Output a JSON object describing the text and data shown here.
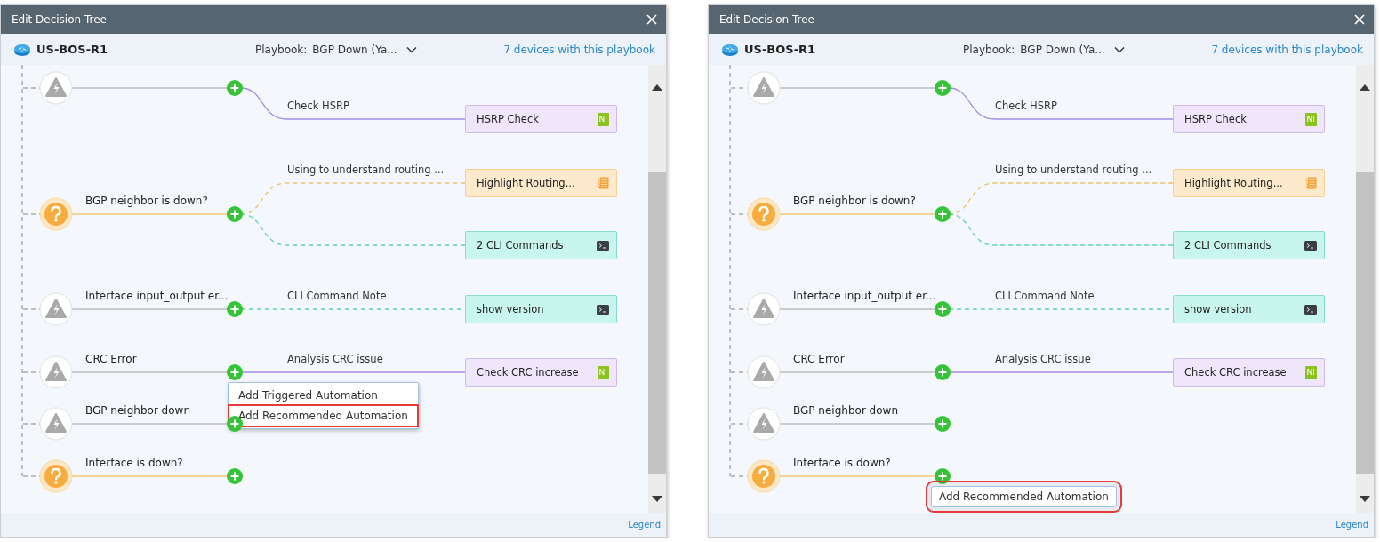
{
  "panels": [
    {
      "title": "Edit Decision Tree",
      "device": "US-BOS-R1",
      "playbook_label": "Playbook:",
      "playbook_value": "BGP Down (Ya...",
      "devices_link": "7 devices with this playbook",
      "legend": "Legend",
      "nodes": [
        {
          "kind": "symptom",
          "branches": [
            {
              "label": "Check HSRP",
              "automation": {
                "kind": "ni",
                "label": "HSRP Check",
                "badge": "NI"
              }
            }
          ]
        },
        {
          "kind": "question",
          "label": "BGP neighbor is down?",
          "branches": [
            {
              "label": "Using to understand routing ...",
              "automation": {
                "kind": "doc",
                "label": "Highlight Routing..."
              }
            },
            {
              "automation": {
                "kind": "cli",
                "label": "2 CLI Commands"
              }
            }
          ]
        },
        {
          "kind": "symptom",
          "label": "Interface input_output er...",
          "branches": [
            {
              "label": "CLI Command Note",
              "automation": {
                "kind": "cli",
                "label": "show version"
              }
            }
          ]
        },
        {
          "kind": "symptom",
          "label": "CRC Error",
          "branches": [
            {
              "label": "Analysis CRC issue",
              "automation": {
                "kind": "ni",
                "label": "Check CRC increase",
                "badge": "NI"
              }
            }
          ],
          "menu": {
            "kind": "list",
            "items": [
              {
                "label": "Add Triggered Automation",
                "highlighted": false
              },
              {
                "label": "Add Recommended Automation",
                "highlighted": true
              }
            ]
          }
        },
        {
          "kind": "symptom",
          "label": "BGP neighbor down"
        },
        {
          "kind": "question",
          "label": "Interface is down?"
        }
      ]
    },
    {
      "title": "Edit Decision Tree",
      "device": "US-BOS-R1",
      "playbook_label": "Playbook:",
      "playbook_value": "BGP Down (Ya...",
      "devices_link": "7 devices with this playbook",
      "legend": "Legend",
      "nodes": [
        {
          "kind": "symptom",
          "branches": [
            {
              "label": "Check HSRP",
              "automation": {
                "kind": "ni",
                "label": "HSRP Check",
                "badge": "NI"
              }
            }
          ]
        },
        {
          "kind": "question",
          "label": "BGP neighbor is down?",
          "branches": [
            {
              "label": "Using to understand routing ...",
              "automation": {
                "kind": "doc",
                "label": "Highlight Routing..."
              }
            },
            {
              "automation": {
                "kind": "cli",
                "label": "2 CLI Commands"
              }
            }
          ]
        },
        {
          "kind": "symptom",
          "label": "Interface input_output er...",
          "branches": [
            {
              "label": "CLI Command Note",
              "automation": {
                "kind": "cli",
                "label": "show version"
              }
            }
          ]
        },
        {
          "kind": "symptom",
          "label": "CRC Error",
          "branches": [
            {
              "label": "Analysis CRC issue",
              "automation": {
                "kind": "ni",
                "label": "Check CRC increase",
                "badge": "NI"
              }
            }
          ]
        },
        {
          "kind": "symptom",
          "label": "BGP neighbor down"
        },
        {
          "kind": "question",
          "label": "Interface is down?",
          "menu": {
            "kind": "single",
            "items": [
              {
                "label": "Add Recommended Automation",
                "highlighted": true
              }
            ]
          }
        }
      ]
    }
  ]
}
